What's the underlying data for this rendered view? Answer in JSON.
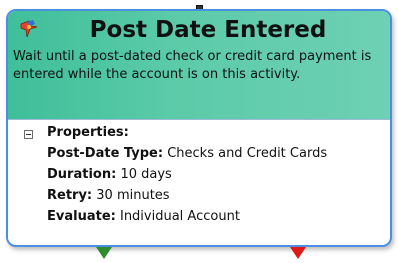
{
  "node": {
    "title": "Post Date Entered",
    "icon": "pin-icon",
    "description": "Wait until a post-dated check or credit card payment is entered while the account is on this activity.",
    "properties_heading": "Properties:",
    "properties": [
      {
        "key": "Post-Date Type:",
        "value": "Checks and Credit Cards"
      },
      {
        "key": "Duration:",
        "value": "10 days"
      },
      {
        "key": "Retry:",
        "value": "30 minutes"
      },
      {
        "key": "Evaluate:",
        "value": "Individual Account"
      }
    ]
  },
  "connectors": {
    "success_color": "#2e8b2e",
    "failure_color": "#e01818"
  },
  "colors": {
    "header": "#5ccba8",
    "border": "#4a8fe0"
  }
}
